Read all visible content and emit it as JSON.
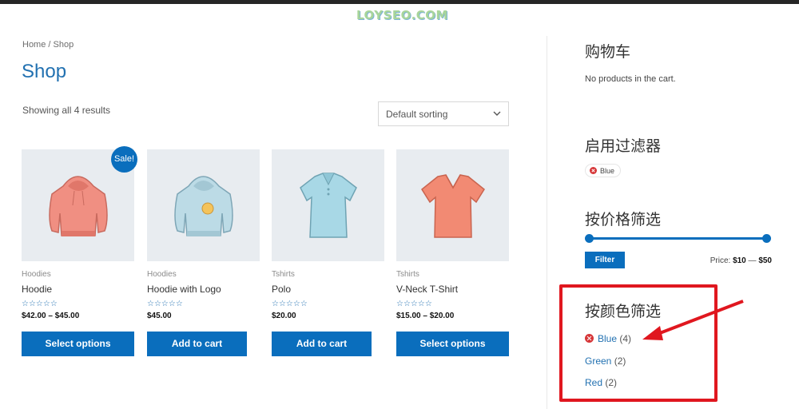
{
  "watermark": "LOYSEO.COM",
  "breadcrumb": "Home / Shop",
  "page_title": "Shop",
  "result_count": "Showing all 4 results",
  "sorting": {
    "selected": "Default sorting"
  },
  "sale_badge": "Sale!",
  "products": [
    {
      "category": "Hoodies",
      "name": "Hoodie",
      "stars": "☆☆☆☆☆",
      "price": "$42.00 – $45.00",
      "button": "Select options"
    },
    {
      "category": "Hoodies",
      "name": "Hoodie with Logo",
      "stars": "☆☆☆☆☆",
      "price": "$45.00",
      "button": "Add to cart"
    },
    {
      "category": "Tshirts",
      "name": "Polo",
      "stars": "☆☆☆☆☆",
      "price": "$20.00",
      "button": "Add to cart"
    },
    {
      "category": "Tshirts",
      "name": "V-Neck T-Shirt",
      "stars": "☆☆☆☆☆",
      "price": "$15.00 – $20.00",
      "button": "Select options"
    }
  ],
  "sidebar": {
    "cart": {
      "title": "购物车",
      "empty": "No products in the cart."
    },
    "active_filters": {
      "title": "启用过滤器",
      "chip": "Blue"
    },
    "price_filter": {
      "title": "按价格筛选",
      "button": "Filter",
      "label": "Price:",
      "min": "$10",
      "sep": "—",
      "max": "$50"
    },
    "color_filter": {
      "title": "按颜色筛选",
      "items": [
        {
          "name": "Blue",
          "count": "(4)"
        },
        {
          "name": "Green",
          "count": "(2)"
        },
        {
          "name": "Red",
          "count": "(2)"
        }
      ]
    }
  },
  "colors": {
    "accent": "#0a6ebd",
    "link": "#2271b1",
    "annotation": "#e0171f"
  }
}
